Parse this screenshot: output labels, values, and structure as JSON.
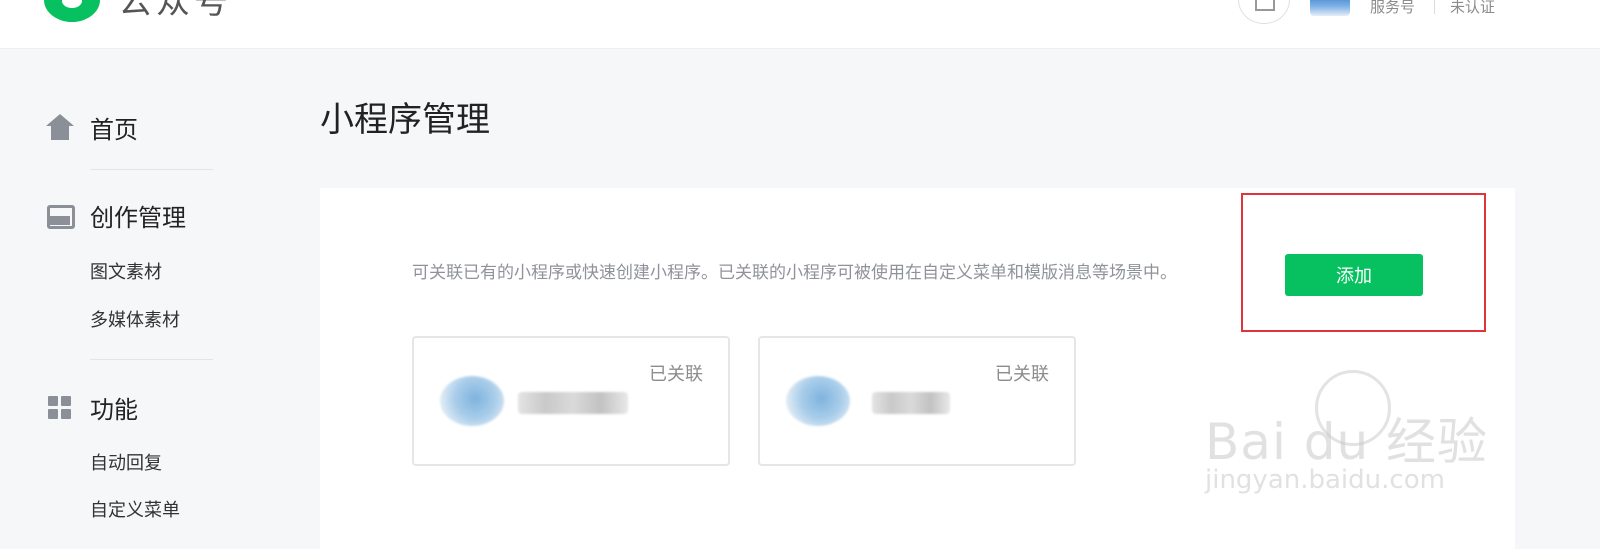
{
  "header": {
    "brand": "公众号",
    "account_type": "服务号",
    "verify_status": "未认证"
  },
  "sidebar": {
    "sections": [
      {
        "label": "首页",
        "icon": "home-icon",
        "items": []
      },
      {
        "label": "创作管理",
        "icon": "inbox-icon",
        "items": [
          "图文素材",
          "多媒体素材"
        ]
      },
      {
        "label": "功能",
        "icon": "grid-icon",
        "items": [
          "自动回复",
          "自定义菜单"
        ]
      }
    ]
  },
  "main": {
    "title": "小程序管理",
    "description": "可关联已有的小程序或快速创建小程序。已关联的小程序可被使用在自定义菜单和模版消息等场景中。",
    "add_button": "添加",
    "cards": [
      {
        "status": "已关联"
      },
      {
        "status": "已关联"
      }
    ]
  },
  "watermark": {
    "main": "Bai du 经验",
    "sub": "jingyan.baidu.com"
  },
  "colors": {
    "accent": "#07c160",
    "highlight_border": "#e0333b",
    "background": "#f6f7f9"
  }
}
